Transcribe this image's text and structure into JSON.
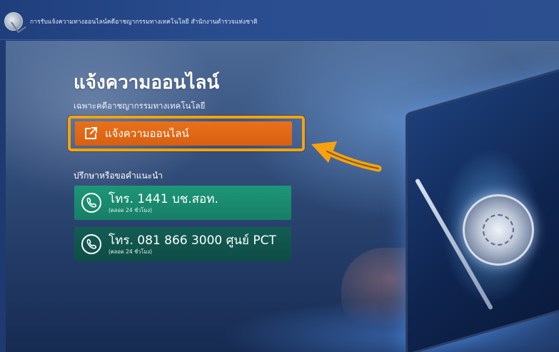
{
  "header": {
    "title": "การรับแจ้งความทางออนไลน์คดีอาชญากรรมทางเทคโนโลยี สำนักงานตำรวจแห่งชาติ"
  },
  "hero": {
    "headline": "แจ้งความออนไลน์",
    "subheadline": "เฉพาะคดีอาชญากรรมทางเทคโนโลยี",
    "report_button_label": "แจ้งความออนไลน์",
    "consult_label": "ปรึกษาหรือขอคำแนะนำ",
    "hotlines": [
      {
        "number": "โทร. 1441 บช.สอท.",
        "hours": "(ตลอด 24 ชั่วโมง)"
      },
      {
        "number": "โทร. 081 866 3000 ศูนย์ PCT",
        "hours": "(ตลอด 24 ชั่วโมง)"
      }
    ]
  },
  "colors": {
    "report_button": "#e0661a",
    "highlight_border": "#f7a20d",
    "hotline_1": "#1e9678",
    "hotline_2": "#135d54",
    "header_bg": "#2a4d8f"
  },
  "icons": {
    "logo": "police-seal-logo",
    "report": "edit-external-icon",
    "phone": "phone-icon",
    "annotation": "arrow-icon"
  }
}
